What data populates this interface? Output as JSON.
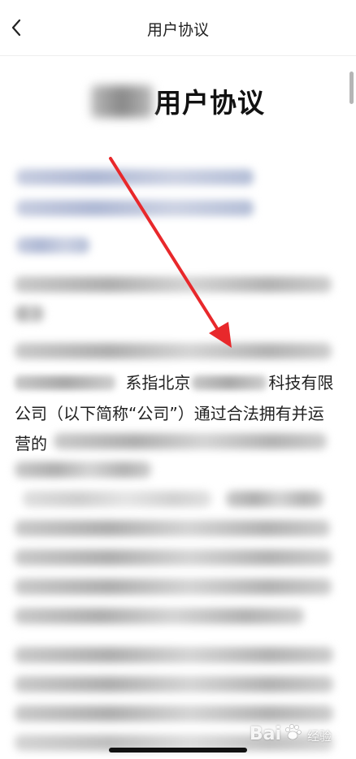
{
  "navbar": {
    "title": "用户协议",
    "back_icon": "chevron-left-icon"
  },
  "document": {
    "title_suffix": "用户协议",
    "clear_line_1_text": "系指北京",
    "clear_line_1_tail": "科技有限",
    "clear_line_2": "公司（以下简称“公司”）通过合法拥有并运",
    "clear_line_3": "营的"
  },
  "annotation": {
    "arrow_color": "#e8282b"
  },
  "watermark": {
    "brand": "Bai",
    "sub": "经验"
  },
  "colors": {
    "accent_arrow": "#e8282b",
    "text": "#222222",
    "background": "#ffffff"
  }
}
